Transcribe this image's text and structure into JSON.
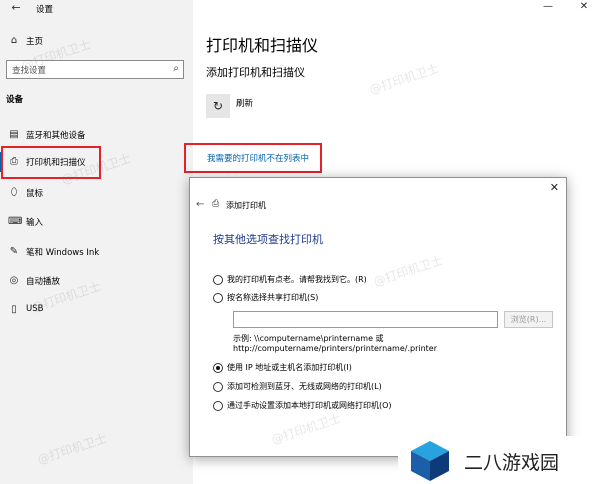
{
  "window": {
    "title": "设置",
    "minimize_glyph": "—",
    "close_glyph": "✕"
  },
  "sidebar": {
    "home_label": "主页",
    "search_placeholder": "查找设置",
    "section_label": "设备",
    "items": [
      {
        "label": "蓝牙和其他设备",
        "icon": "bluetooth-devices-icon"
      },
      {
        "label": "打印机和扫描仪",
        "icon": "printer-icon",
        "active": true
      },
      {
        "label": "鼠标",
        "icon": "mouse-icon"
      },
      {
        "label": "输入",
        "icon": "keyboard-icon"
      },
      {
        "label": "笔和 Windows Ink",
        "icon": "pen-icon"
      },
      {
        "label": "自动播放",
        "icon": "autoplay-icon"
      },
      {
        "label": "USB",
        "icon": "usb-icon"
      }
    ]
  },
  "main": {
    "title": "打印机和扫描仪",
    "subtitle": "添加打印机和扫描仪",
    "refresh_label": "刷新",
    "missing_printer_link": "我需要的打印机不在列表中"
  },
  "dialog": {
    "title": "添加打印机",
    "heading": "按其他选项查找打印机",
    "options": [
      {
        "label": "我的打印机有点老。请帮我找到它。(R)",
        "selected": false
      },
      {
        "label": "按名称选择共享打印机(S)",
        "selected": false
      },
      {
        "label": "使用 IP 地址或主机名添加打印机(I)",
        "selected": true
      },
      {
        "label": "添加可检测到蓝牙、无线或网络的打印机(L)",
        "selected": false
      },
      {
        "label": "通过手动设置添加本地打印机或网络打印机(O)",
        "selected": false
      }
    ],
    "share_input_value": "",
    "browse_label": "浏览(R)...",
    "example_line1": "示例: \\\\computername\\printername 或",
    "example_line2": "http://computername/printers/printername/.printer"
  },
  "watermark": {
    "text": "@打印机卫士",
    "logo_text": "二八游戏园"
  },
  "colors": {
    "accent": "#0063b1",
    "highlight_box": "#e2232a",
    "dialog_heading": "#1e3a8a"
  }
}
